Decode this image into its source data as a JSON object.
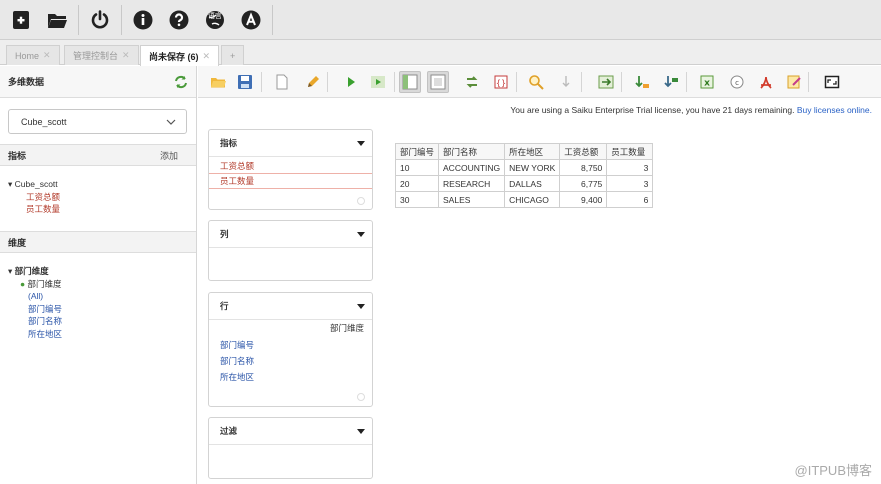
{
  "top_toolbar": {
    "buttons": [
      {
        "name": "new-query-icon"
      },
      {
        "name": "open-query-icon"
      },
      {
        "name": "power-icon"
      },
      {
        "name": "info-icon"
      },
      {
        "name": "help-icon"
      },
      {
        "name": "language-icon",
        "label": "语言"
      },
      {
        "name": "admin-icon"
      }
    ]
  },
  "tabs": [
    {
      "label": "Home"
    },
    {
      "label": "管理控制台"
    },
    {
      "label": "尚未保存 (6)"
    },
    {
      "label": "+"
    }
  ],
  "sidebar": {
    "title": "多维数据",
    "cube_selected": "Cube_scott",
    "measures_header": "指标",
    "add_label": "添加",
    "cube_node": "Cube_scott",
    "measures": [
      "工资总额",
      "员工数量"
    ],
    "dimensions_header": "维度",
    "dimension_node": "部门维度",
    "hierarchy": "部门维度",
    "levels": [
      "(All)",
      "部门编号",
      "部门名称",
      "所在地区"
    ]
  },
  "license": {
    "text": "You are using a Saiku Enterprise Trial license, you have 21 days remaining.",
    "link": "Buy licenses online."
  },
  "zones": {
    "measures": {
      "title": "指标",
      "items": [
        "工资总额",
        "员工数量"
      ]
    },
    "columns": {
      "title": "列"
    },
    "rows": {
      "title": "行",
      "dimension": "部门维度",
      "items": [
        "部门编号",
        "部门名称",
        "所在地区"
      ]
    },
    "filter": {
      "title": "过滤"
    }
  },
  "table": {
    "headers": [
      "部门编号",
      "部门名称",
      "所在地区",
      "工资总额",
      "员工数量"
    ],
    "rows": [
      [
        "10",
        "ACCOUNTING",
        "NEW YORK",
        "8,750",
        "3"
      ],
      [
        "20",
        "RESEARCH",
        "DALLAS",
        "6,775",
        "3"
      ],
      [
        "30",
        "SALES",
        "CHICAGO",
        "9,400",
        "6"
      ]
    ]
  },
  "watermark": "@ITPUB博客"
}
